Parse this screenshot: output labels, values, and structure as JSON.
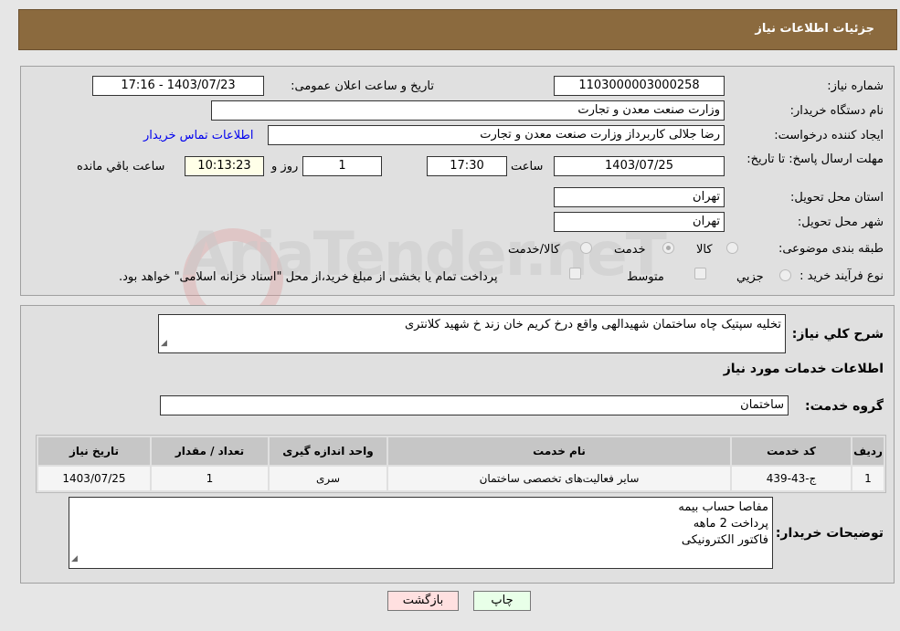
{
  "header": {
    "title": "جزئیات اطلاعات نیاز"
  },
  "fields": {
    "need_number_label": "شماره نیاز:",
    "need_number": "1103000003000258",
    "announce_label": "تاریخ و ساعت اعلان عمومی:",
    "announce_value": "1403/07/23 - 17:16",
    "buyer_org_label": "نام دستگاه خریدار:",
    "buyer_org": "وزارت صنعت معدن و تجارت",
    "creator_label": "ایجاد کننده درخواست:",
    "creator": "رضا جلالی کاربرداز وزارت صنعت معدن و تجارت",
    "contact_link": "اطلاعات تماس خریدار",
    "deadline_label": "مهلت ارسال پاسخ: تا تاریخ:",
    "deadline_date": "1403/07/25",
    "time_label": "ساعت",
    "deadline_time": "17:30",
    "days": "1",
    "days_label": "روز و",
    "remaining": "10:13:23",
    "remaining_label": "ساعت باقي مانده",
    "province_label": "استان محل تحویل:",
    "province": "تهران",
    "city_label": "شهر محل تحویل:",
    "city": "تهران",
    "category_label": "طبقه بندی موضوعی:",
    "category_options": [
      "کالا",
      "خدمت",
      "کالا/خدمت"
    ],
    "category_selected": "خدمت",
    "process_label": "نوع فرآیند خرید :",
    "process_options": [
      "جزیي",
      "متوسط"
    ],
    "process_note": "پرداخت تمام یا بخشی از مبلغ خرید،از محل \"اسناد خزانه اسلامی\" خواهد بود."
  },
  "details": {
    "summary_label": "شرح کلي نیاز:",
    "summary": "تخلیه سپتیک چاه ساختمان شهیدالهی واقع درخ کریم خان زند خ شهید کلانتری",
    "services_title": "اطلاعات خدمات مورد نیاز",
    "group_label": "گروه خدمت:",
    "group": "ساختمان",
    "table": {
      "headers": [
        "ردیف",
        "کد خدمت",
        "نام خدمت",
        "واحد اندازه گیری",
        "تعداد / مقدار",
        "تاریخ نیاز"
      ],
      "rows": [
        [
          "1",
          "ج-43-439",
          "سایر فعالیت‌های تخصصی ساختمان",
          "سری",
          "1",
          "1403/07/25"
        ]
      ]
    },
    "notes_label": "توضیحات خریدار:",
    "notes": [
      "مفاصا حساب بیمه",
      "پرداخت 2 ماهه",
      "فاکتور الکترونیکی"
    ]
  },
  "buttons": {
    "print": "چاپ",
    "back": "بازگشت"
  },
  "watermark": "AriaTender.neT",
  "colors": {
    "header": "#8b6a3e",
    "print_bg": "#e8ffe8",
    "back_bg": "#ffe0e0",
    "link": "#0000ee"
  }
}
